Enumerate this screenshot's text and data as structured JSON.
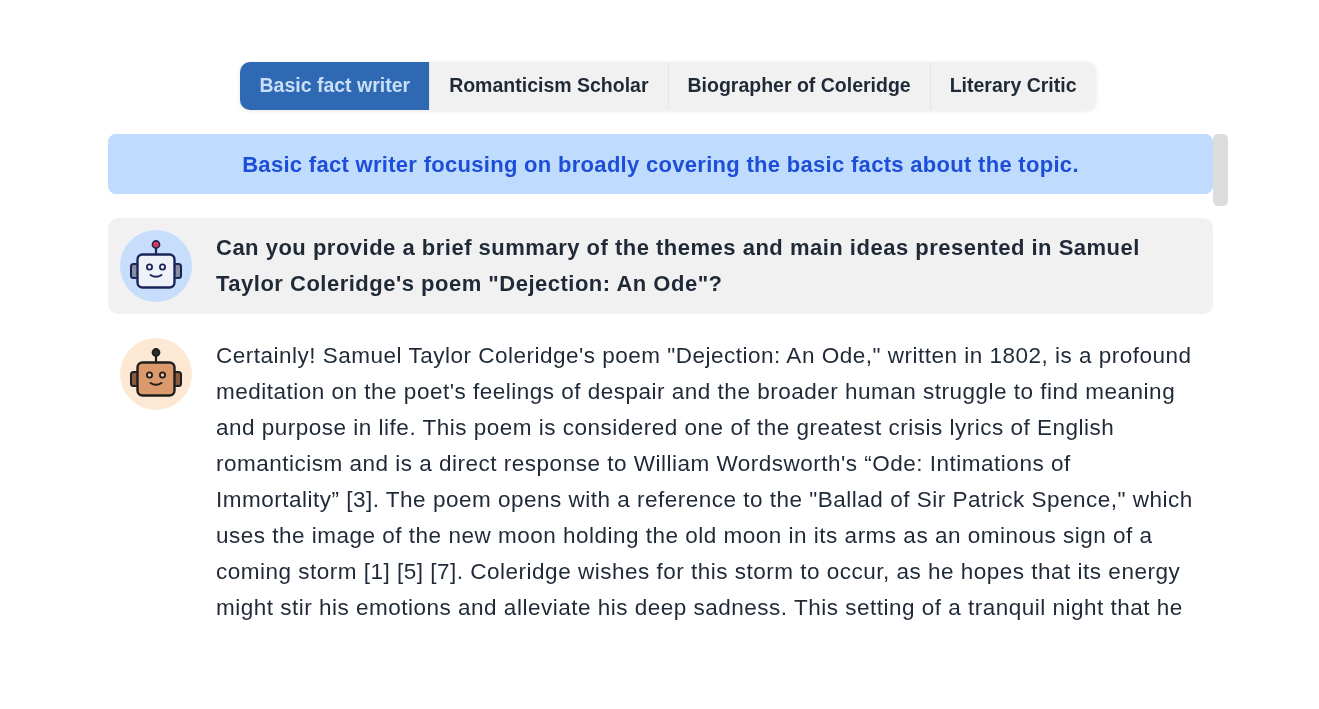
{
  "persona_tabs": [
    {
      "label": "Basic fact writer",
      "selected": true
    },
    {
      "label": "Romanticism Scholar",
      "selected": false
    },
    {
      "label": "Biographer of Coleridge",
      "selected": false
    },
    {
      "label": "Literary Critic",
      "selected": false
    }
  ],
  "persona_description": "Basic fact writer focusing on broadly covering the basic facts about the topic.",
  "messages": [
    {
      "kind": "question",
      "text": "Can you provide a brief summary of the themes and main ideas presented in Samuel Taylor Coleridge's poem \"Dejection: An Ode\"?"
    },
    {
      "kind": "answer",
      "text": "Certainly! Samuel Taylor Coleridge's poem \"Dejection: An Ode,\" written in 1802, is a profound meditation on the poet's feelings of despair and the broader human struggle to find meaning and purpose in life. This poem is considered one of the greatest crisis lyrics of English romanticism and is a direct response to William Wordsworth's “Ode: Intimations of Immortality” [3]. The poem opens with a reference to the \"Ballad of Sir Patrick Spence,\" which uses the image of the new moon holding the old moon in its arms as an ominous sign of a coming storm [1] [5] [7]. Coleridge wishes for this storm to occur, as he hopes that its energy might stir his emotions and alleviate his deep sadness. This setting of a tranquil night that he"
    }
  ]
}
